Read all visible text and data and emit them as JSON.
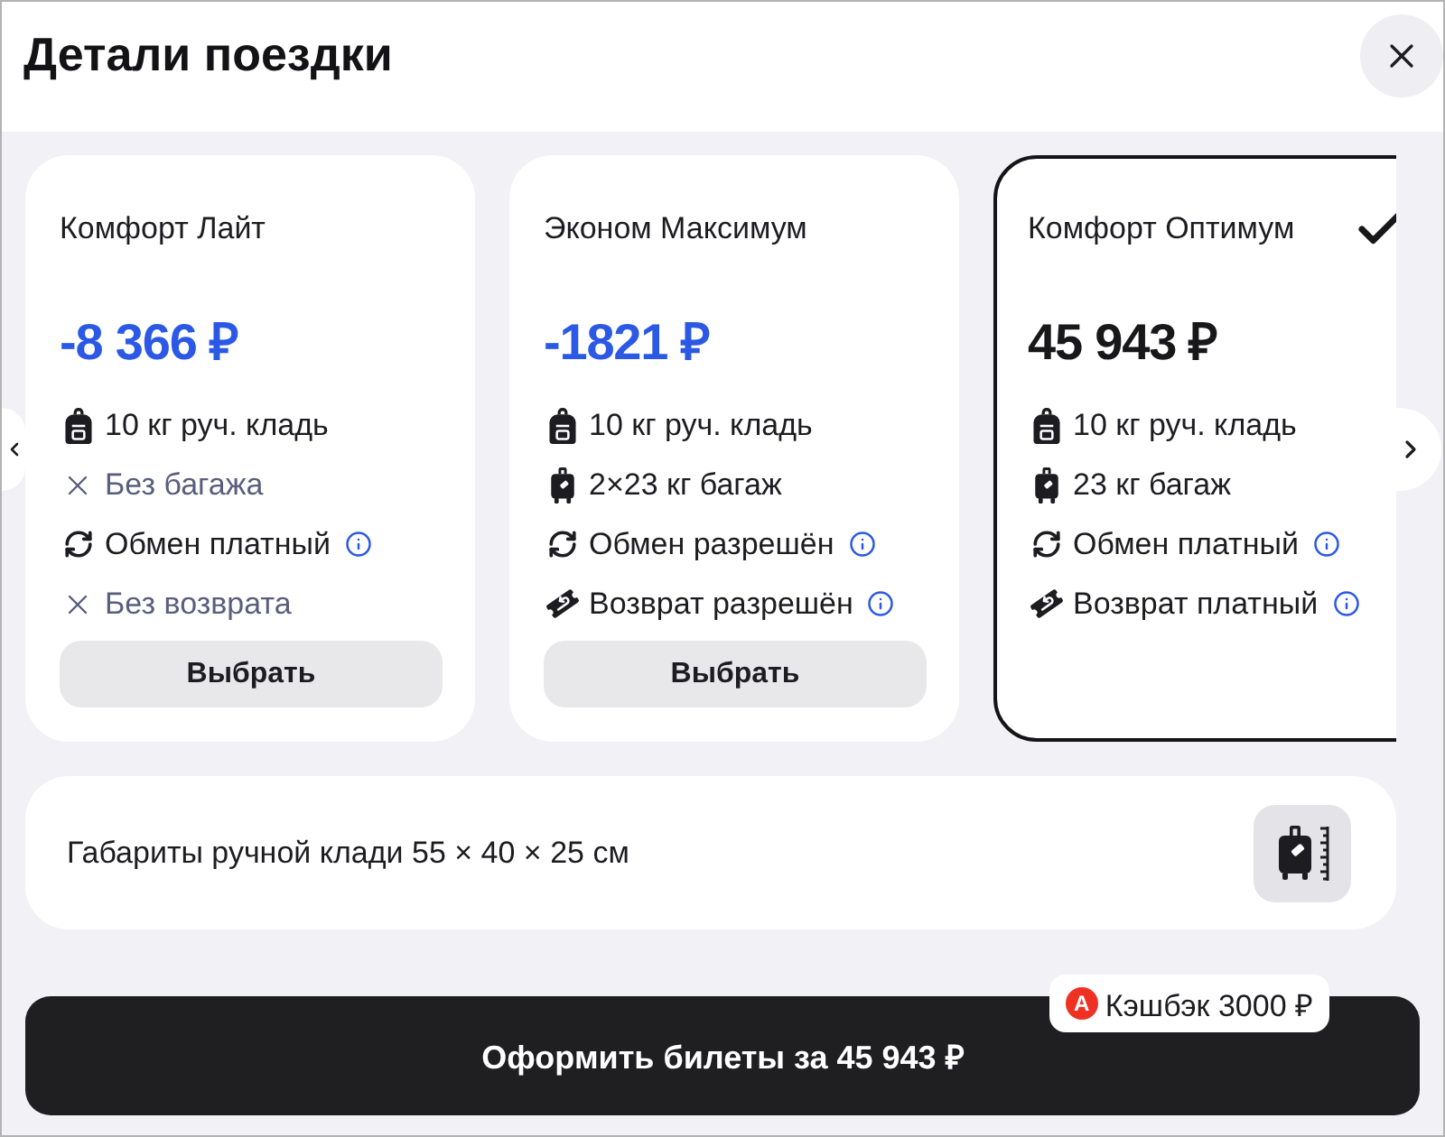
{
  "window": {
    "title": "Детали поездки"
  },
  "fares": [
    {
      "name": "Комфорт Лайт",
      "price": "-8 366 ₽",
      "selected": false,
      "features": [
        {
          "kind": "hand_luggage",
          "text": "10 кг руч. кладь",
          "info": false
        },
        {
          "kind": "unavailable",
          "text": "Без багажа",
          "info": false
        },
        {
          "kind": "exchange",
          "text": "Обмен платный",
          "info": true
        },
        {
          "kind": "unavailable",
          "text": "Без возврата",
          "info": false
        }
      ],
      "button": "Выбрать"
    },
    {
      "name": "Эконом Максимум",
      "price": "-1821 ₽",
      "selected": false,
      "features": [
        {
          "kind": "hand_luggage",
          "text": "10 кг руч. кладь",
          "info": false
        },
        {
          "kind": "baggage",
          "text": "2×23 кг багаж",
          "info": false
        },
        {
          "kind": "exchange",
          "text": "Обмен разрешён",
          "info": true
        },
        {
          "kind": "refund",
          "text": "Возврат разрешён",
          "info": true
        }
      ],
      "button": "Выбрать"
    },
    {
      "name": "Комфорт Оптимум",
      "price": "45 943 ₽",
      "selected": true,
      "features": [
        {
          "kind": "hand_luggage",
          "text": "10 кг руч. кладь",
          "info": false
        },
        {
          "kind": "baggage",
          "text": "23 кг багаж",
          "info": false
        },
        {
          "kind": "exchange",
          "text": "Обмен платный",
          "info": true
        },
        {
          "kind": "refund",
          "text": "Возврат платный",
          "info": true
        }
      ]
    }
  ],
  "hand_luggage_note": {
    "text": "Габариты ручной клади 55 × 40 × 25 см"
  },
  "checkout": {
    "label": "Оформить билеты за 45 943 ₽",
    "cashback": {
      "logo": "А",
      "text": "Кэшбэк 3000 ₽"
    }
  }
}
